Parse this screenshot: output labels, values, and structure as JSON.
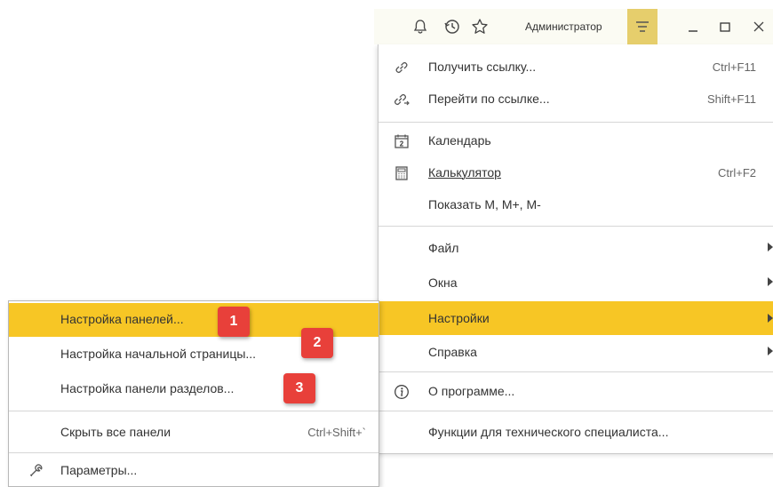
{
  "topbar": {
    "user": "Администратор",
    "icons": [
      "bell-icon",
      "history-icon",
      "star-icon",
      "main-menu-icon",
      "minimize-icon",
      "maximize-icon",
      "close-icon"
    ]
  },
  "main_menu": {
    "items": [
      {
        "label": "Получить ссылку...",
        "shortcut": "Ctrl+F11",
        "icon": "link-icon"
      },
      {
        "label": "Перейти по ссылке...",
        "shortcut": "Shift+F11",
        "icon": "go-to-link-icon"
      },
      {
        "label": "Календарь",
        "shortcut": "",
        "icon": "calendar-icon"
      },
      {
        "label": "Калькулятор",
        "shortcut": "Ctrl+F2",
        "icon": "calculator-icon"
      },
      {
        "label": "Показать М, М+, М-",
        "shortcut": ""
      },
      {
        "label": "Файл",
        "submenu": true
      },
      {
        "label": "Окна",
        "submenu": true
      },
      {
        "label": "Настройки",
        "submenu": true,
        "active": true
      },
      {
        "label": "Справка",
        "submenu": true
      },
      {
        "label": "О программе...",
        "icon": "info-icon"
      },
      {
        "label": "Функции для технического специалиста..."
      }
    ]
  },
  "sub_menu": {
    "items": [
      {
        "label": "Настройка панелей...",
        "active": true
      },
      {
        "label": "Настройка начальной страницы..."
      },
      {
        "label": "Настройка панели разделов..."
      },
      {
        "label": "Скрыть все панели",
        "shortcut": "Ctrl+Shift+`"
      },
      {
        "label": "Параметры...",
        "icon": "wrench-icon"
      }
    ]
  },
  "badges": [
    "1",
    "2",
    "3"
  ],
  "colors": {
    "highlight": "#f7c625",
    "menu_button": "#e6ce6c",
    "badge": "#e8403a",
    "topbar": "#fbfbf3"
  }
}
